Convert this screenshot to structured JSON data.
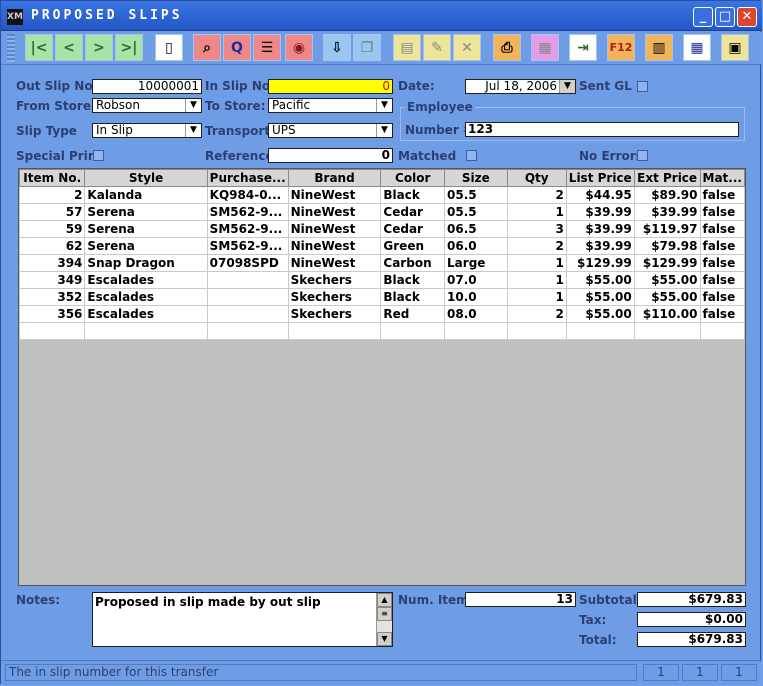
{
  "window": {
    "title": "PROPOSED SLIPS",
    "app_icon": "XM",
    "minimize": "_",
    "maximize": "□",
    "close": "✕"
  },
  "toolbar": {
    "first": "|<",
    "prev": "<",
    "next": ">",
    "last": ">|",
    "f12": "F12"
  },
  "form": {
    "out_slip_label": "Out Slip No.",
    "out_slip_value": "10000001",
    "in_slip_label": "In Slip No.",
    "in_slip_value": "0",
    "date_label": "Date:",
    "date_value": "Jul 18, 2006",
    "sent_gl_label": "Sent GL",
    "from_store_label": "From Store:",
    "from_store_value": "Robson",
    "to_store_label": "To Store:",
    "to_store_value": "Pacific",
    "employee_label": "Employee",
    "slip_type_label": "Slip Type",
    "slip_type_value": "In Slip",
    "transport_label": "Transport:",
    "transport_value": "UPS",
    "number_label": "Number #:",
    "number_value": "123",
    "special_print_label": "Special Print",
    "reference_label": "Reference",
    "reference_value": "0",
    "matched_label": "Matched",
    "no_errors_label": "No Errors"
  },
  "grid": {
    "columns": [
      "Item No.",
      "Style",
      "Purchase...",
      "Brand",
      "Color",
      "Size",
      "Qty",
      "List Price",
      "Ext Price",
      "Mat..."
    ],
    "rows": [
      [
        "2",
        "Kalanda",
        "KQ984-0...",
        "NineWest",
        "Black",
        "05.5",
        "2",
        "$44.95",
        "$89.90",
        "false"
      ],
      [
        "57",
        "Serena",
        "SM562-9...",
        "NineWest",
        "Cedar",
        "05.5",
        "1",
        "$39.99",
        "$39.99",
        "false"
      ],
      [
        "59",
        "Serena",
        "SM562-9...",
        "NineWest",
        "Cedar",
        "06.5",
        "3",
        "$39.99",
        "$119.97",
        "false"
      ],
      [
        "62",
        "Serena",
        "SM562-9...",
        "NineWest",
        "Green",
        "06.0",
        "2",
        "$39.99",
        "$79.98",
        "false"
      ],
      [
        "394",
        "Snap Dragon",
        "07098SPD",
        "NineWest",
        "Carbon",
        "Large",
        "1",
        "$129.99",
        "$129.99",
        "false"
      ],
      [
        "349",
        "Escalades",
        "",
        "Skechers",
        "Black",
        "07.0",
        "1",
        "$55.00",
        "$55.00",
        "false"
      ],
      [
        "352",
        "Escalades",
        "",
        "Skechers",
        "Black",
        "10.0",
        "1",
        "$55.00",
        "$55.00",
        "false"
      ],
      [
        "356",
        "Escalades",
        "",
        "Skechers",
        "Red",
        "08.0",
        "2",
        "$55.00",
        "$110.00",
        "false"
      ],
      [
        "",
        "",
        "",
        "",
        "",
        "",
        "",
        "",
        "",
        ""
      ]
    ]
  },
  "footer": {
    "notes_label": "Notes:",
    "notes_value": "Proposed in slip made by out slip",
    "num_items_label": "Num. Items",
    "num_items_value": "13",
    "subtotal_label": "Subtotal:",
    "subtotal_value": "$679.83",
    "tax_label": "Tax:",
    "tax_value": "$0.00",
    "total_label": "Total:",
    "total_value": "$679.83"
  },
  "status": {
    "text": "The in slip number for this transfer",
    "cell1": "1",
    "cell2": "1",
    "cell3": "1"
  }
}
